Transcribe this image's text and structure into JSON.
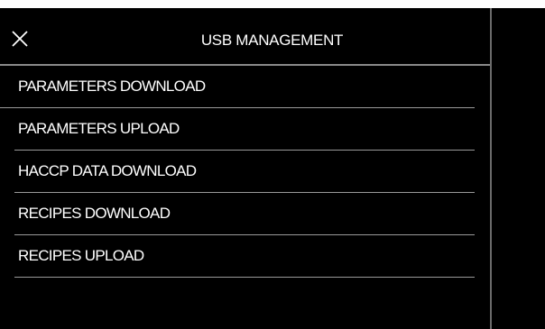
{
  "header": {
    "title": "USB MANAGEMENT",
    "close_icon": "close-icon"
  },
  "menu": {
    "items": [
      {
        "label": "PARAMETERS DOWNLOAD"
      },
      {
        "label": "PARAMETERS UPLOAD"
      },
      {
        "label": "HACCP DATA DOWNLOAD"
      },
      {
        "label": "RECIPES DOWNLOAD"
      },
      {
        "label": "RECIPES UPLOAD"
      }
    ]
  },
  "colors": {
    "background": "#000000",
    "text": "#ffffff",
    "divider": "#9a9a9a",
    "top_strip": "#ffffff"
  }
}
